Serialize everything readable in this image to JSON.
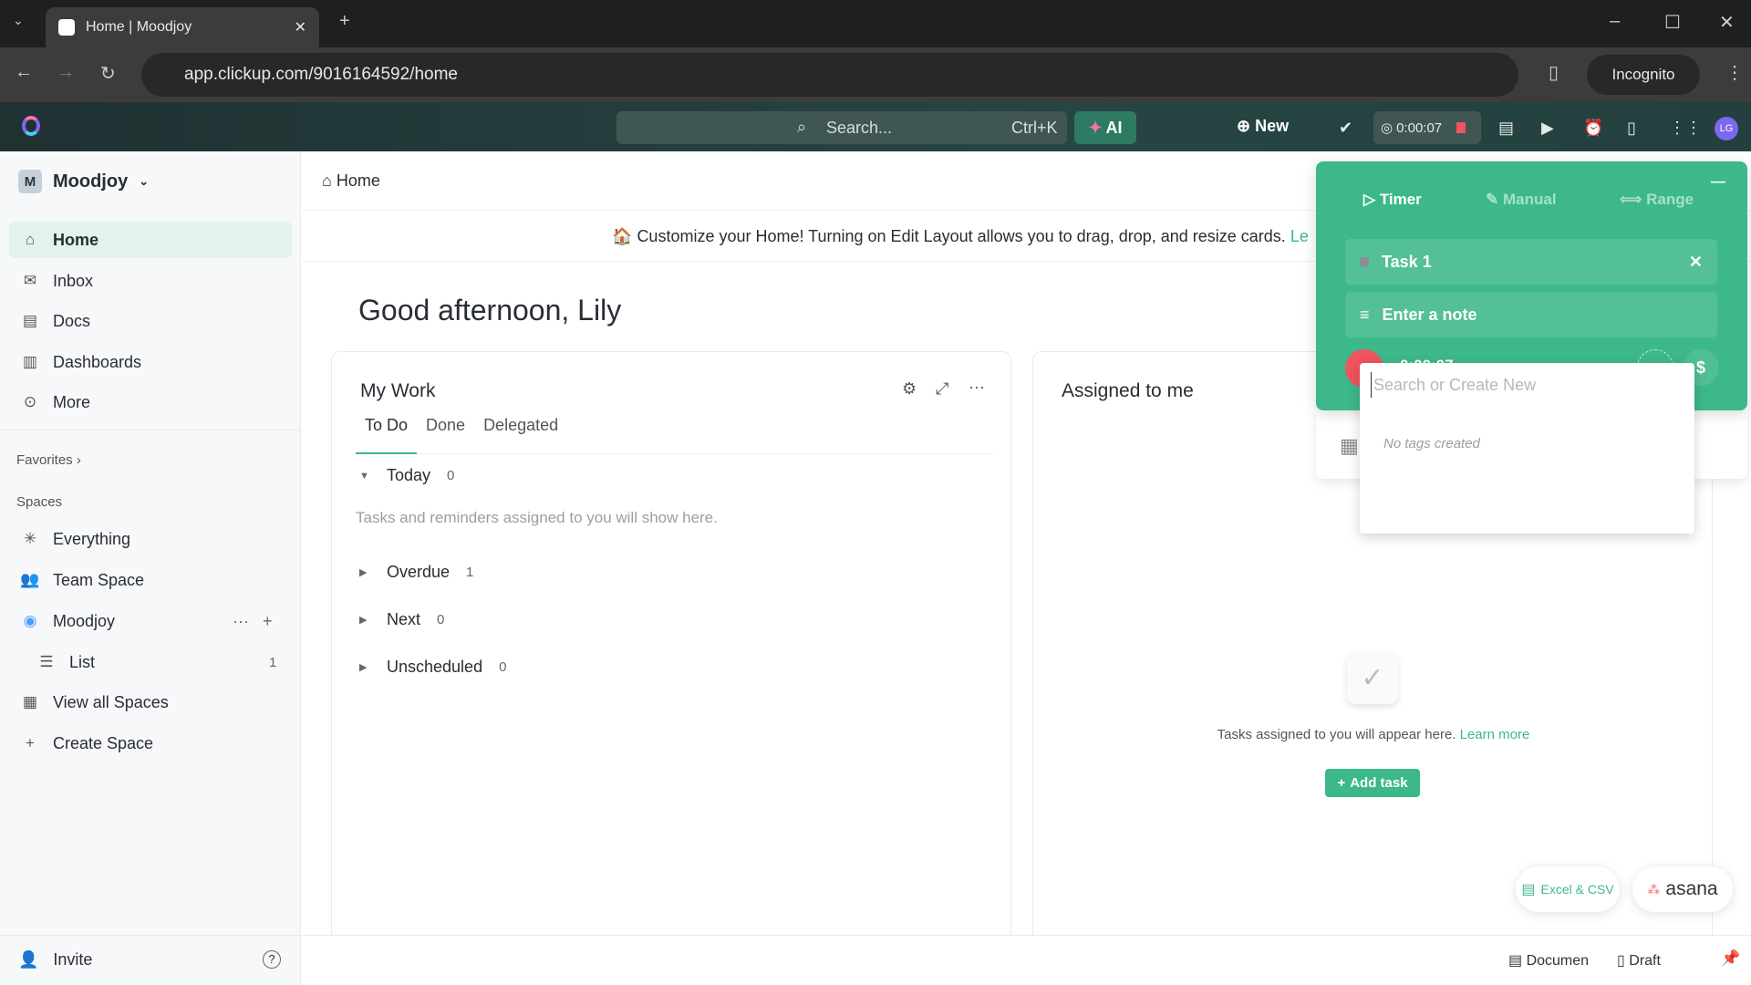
{
  "browser": {
    "tab_title": "Home | Moodjoy",
    "url": "app.clickup.com/9016164592/home",
    "incognito": "Incognito"
  },
  "header": {
    "search_placeholder": "Search...",
    "search_shortcut": "Ctrl+K",
    "ai": "AI",
    "new": "New",
    "timer": "0:00:07",
    "avatar": "LG"
  },
  "sidebar": {
    "workspace_initial": "M",
    "workspace": "Moodjoy",
    "nav": [
      {
        "label": "Home",
        "icon": "home-icon"
      },
      {
        "label": "Inbox",
        "icon": "inbox-icon"
      },
      {
        "label": "Docs",
        "icon": "doc-icon"
      },
      {
        "label": "Dashboards",
        "icon": "dashboard-icon"
      },
      {
        "label": "More",
        "icon": "more-icon"
      }
    ],
    "favorites": "Favorites",
    "spaces": "Spaces",
    "space_items": [
      {
        "label": "Everything"
      },
      {
        "label": "Team Space"
      },
      {
        "label": "Moodjoy"
      },
      {
        "label": "List",
        "count": "1"
      },
      {
        "label": "View all Spaces"
      },
      {
        "label": "Create Space"
      }
    ],
    "invite": "Invite"
  },
  "main": {
    "breadcrumb": "Home",
    "banner": "Customize your Home! Turning on Edit Layout allows you to drag, drop, and resize cards.",
    "banner_link": "Le",
    "greeting": "Good afternoon, Lily",
    "my_work": {
      "title": "My Work",
      "tabs": [
        "To Do",
        "Done",
        "Delegated"
      ],
      "active_tab": "To Do",
      "sections": [
        {
          "label": "Today",
          "count": "0"
        },
        {
          "label": "Overdue",
          "count": "1"
        },
        {
          "label": "Next",
          "count": "0"
        },
        {
          "label": "Unscheduled",
          "count": "0"
        }
      ],
      "empty": "Tasks and reminders assigned to you will show here."
    },
    "assigned": {
      "title": "Assigned to me",
      "empty": "Tasks assigned to you will appear here.",
      "learn_more": "Learn more",
      "add_task": "Add task"
    }
  },
  "timer_panel": {
    "tabs": [
      "Timer",
      "Manual",
      "Range"
    ],
    "task": "Task 1",
    "note_placeholder": "Enter a note",
    "elapsed": "0:00:07",
    "tag_search_placeholder": "Search or Create New",
    "no_tags": "No tags created"
  },
  "imports": {
    "excel": "Excel & CSV",
    "asana": "asana"
  },
  "bottom": {
    "document": "Documen",
    "draft": "Draft"
  },
  "colors": {
    "accent": "#3db88a",
    "stop": "#f0545f"
  }
}
